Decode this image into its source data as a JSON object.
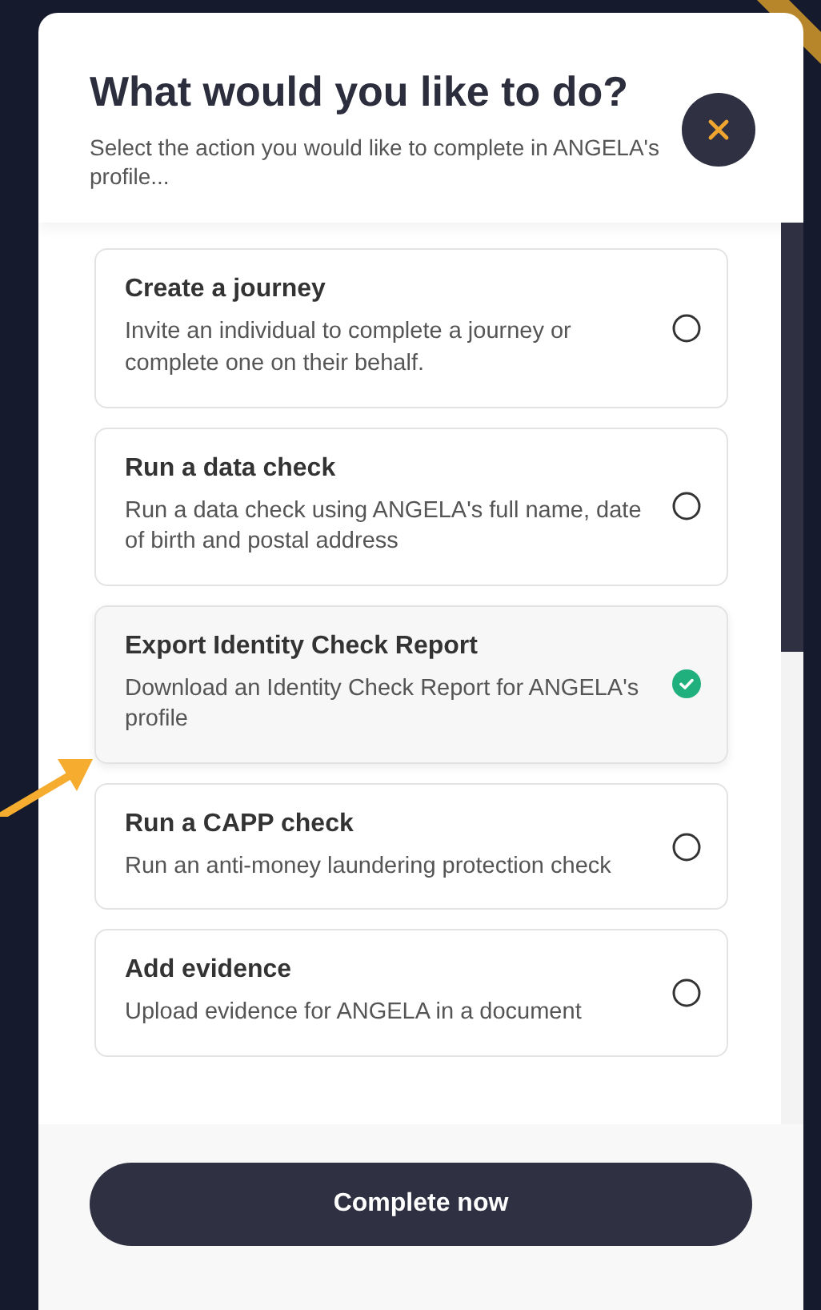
{
  "dialog": {
    "title": "What would you like to do?",
    "subtitle": "Select the action you would like to complete in ANGELA's profile..."
  },
  "options": [
    {
      "title": "Create a journey",
      "description": "Invite an individual to complete a journey or complete one on their behalf.",
      "selected": false
    },
    {
      "title": "Run a data check",
      "description": "Run a data check using ANGELA's full name, date of birth and postal address",
      "selected": false
    },
    {
      "title": "Export Identity Check Report",
      "description": "Download an Identity Check Report for ANGELA's profile",
      "selected": true
    },
    {
      "title": "Run a CAPP check",
      "description": "Run an anti-money laundering protection check",
      "selected": false
    },
    {
      "title": "Add evidence",
      "description": "Upload evidence for ANGELA in a document",
      "selected": false
    }
  ],
  "primary_button": "Complete now"
}
